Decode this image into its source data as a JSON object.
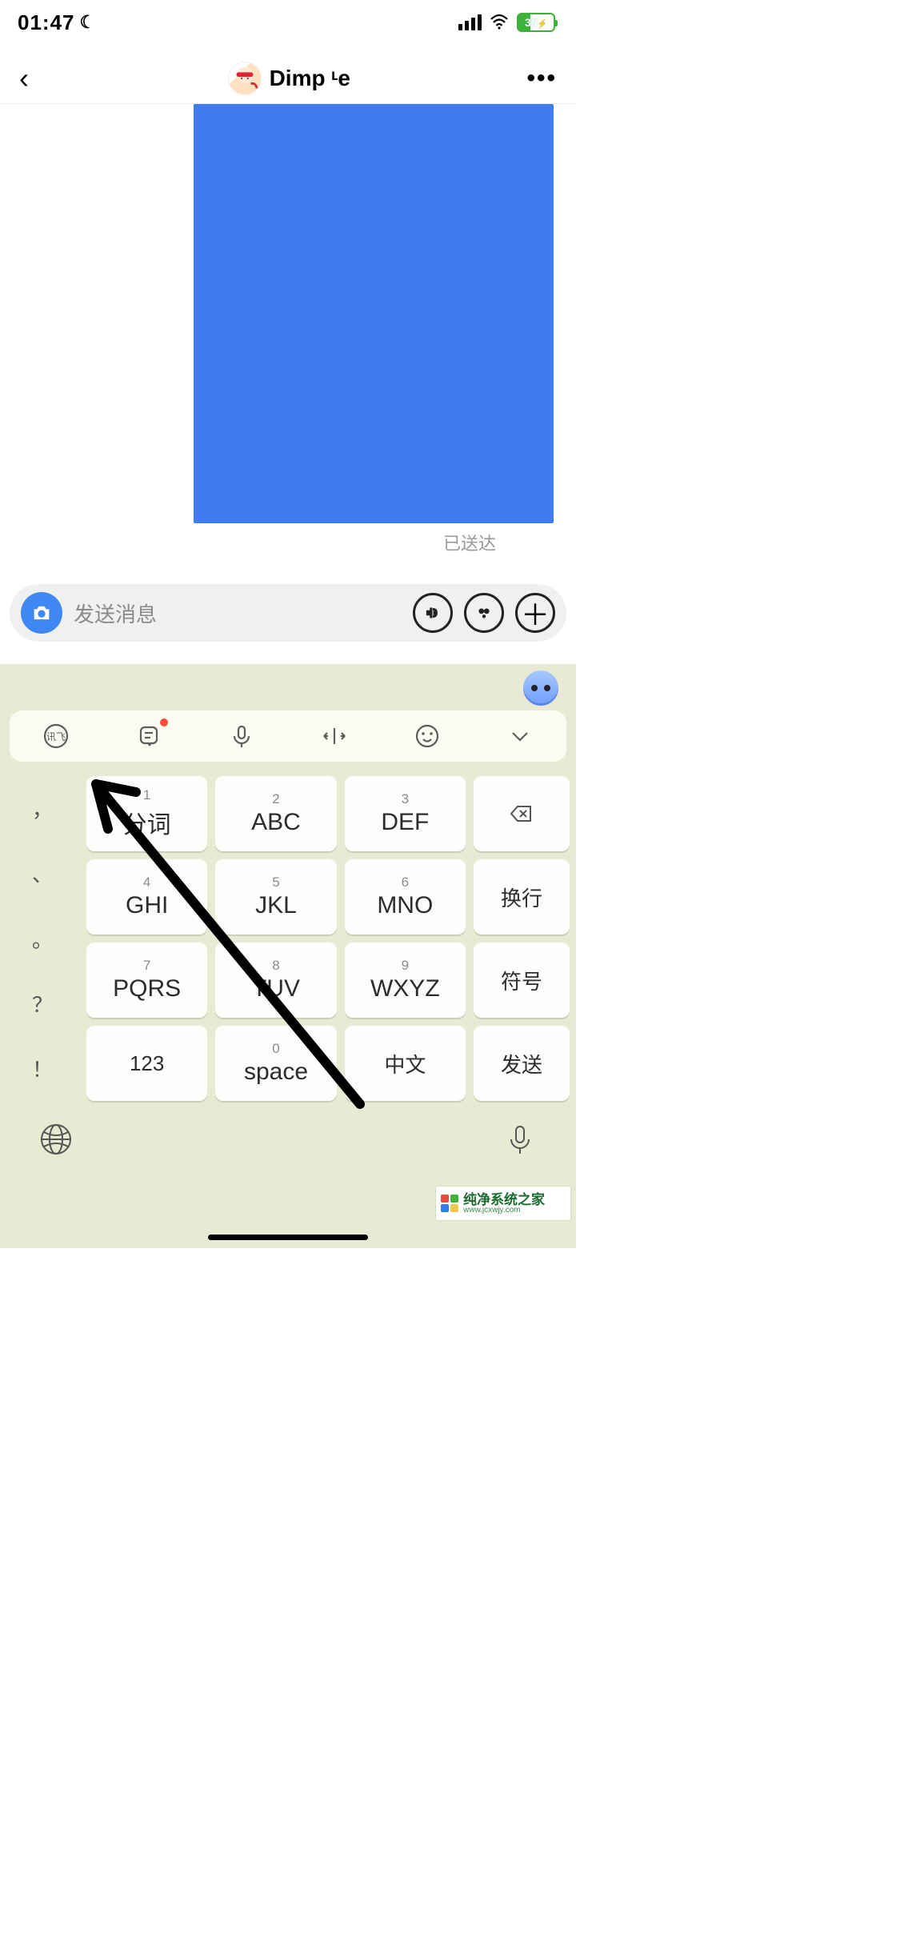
{
  "status": {
    "time": "01:47",
    "battery_pct": "35"
  },
  "nav": {
    "title": "Dimp ᶫe"
  },
  "chat": {
    "delivered": "已送达"
  },
  "input": {
    "placeholder": "发送消息"
  },
  "keypad": {
    "rows": [
      [
        {
          "num": "1",
          "lbl": "分词"
        },
        {
          "num": "2",
          "lbl": "ABC"
        },
        {
          "num": "3",
          "lbl": "DEF"
        }
      ],
      [
        {
          "num": "4",
          "lbl": "GHI"
        },
        {
          "num": "5",
          "lbl": "JKL"
        },
        {
          "num": "6",
          "lbl": "MNO"
        }
      ],
      [
        {
          "num": "7",
          "lbl": "PQRS"
        },
        {
          "num": "8",
          "lbl": "TUV"
        },
        {
          "num": "9",
          "lbl": "WXYZ"
        }
      ]
    ],
    "space": {
      "num": "0",
      "lbl": "space"
    },
    "num_switch": "123",
    "lang": "中文",
    "side_right": {
      "newline": "换行",
      "symbol": "符号",
      "send": "发送"
    },
    "left_syms": [
      "，",
      "、",
      "。",
      "？",
      "！"
    ]
  },
  "watermark": {
    "line1": "纯净系统之家",
    "line2": "www.jcxwjy.com"
  }
}
